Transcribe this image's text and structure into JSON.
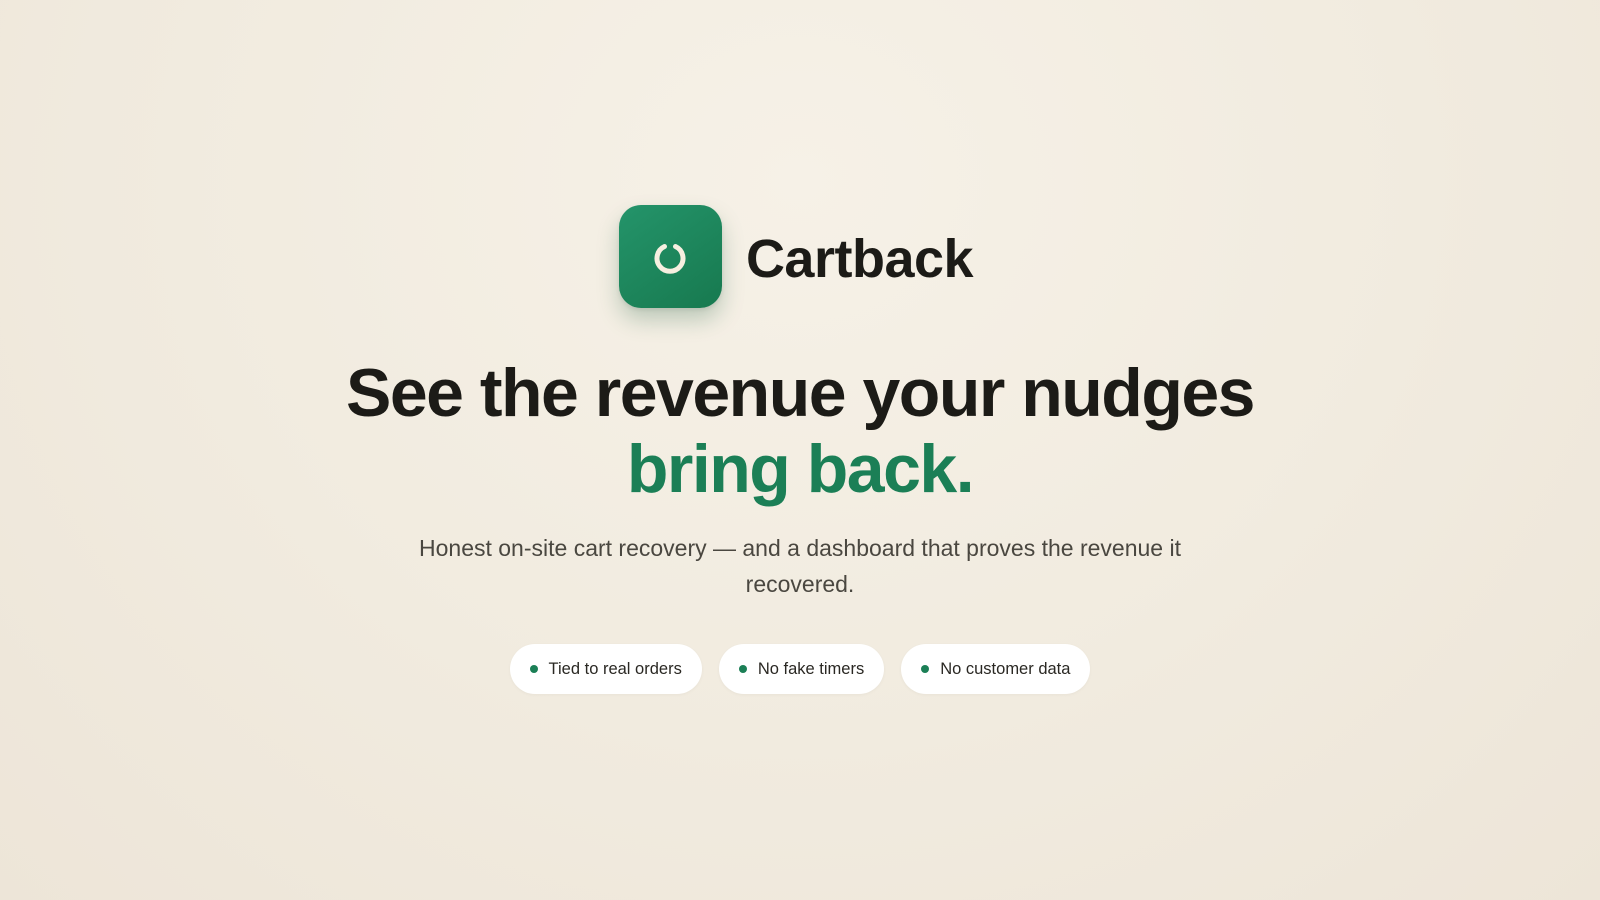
{
  "brand": {
    "name": "Cartback",
    "logo_icon": "refresh-icon",
    "accent_color": "#1b7f56"
  },
  "headline": {
    "line1": "See the revenue your nudges",
    "line2": "bring back."
  },
  "subtitle": "Honest on-site cart recovery — and a dashboard that proves the revenue it recovered.",
  "badges": [
    {
      "label": "Tied to real orders"
    },
    {
      "label": "No fake timers"
    },
    {
      "label": "No customer data"
    }
  ]
}
